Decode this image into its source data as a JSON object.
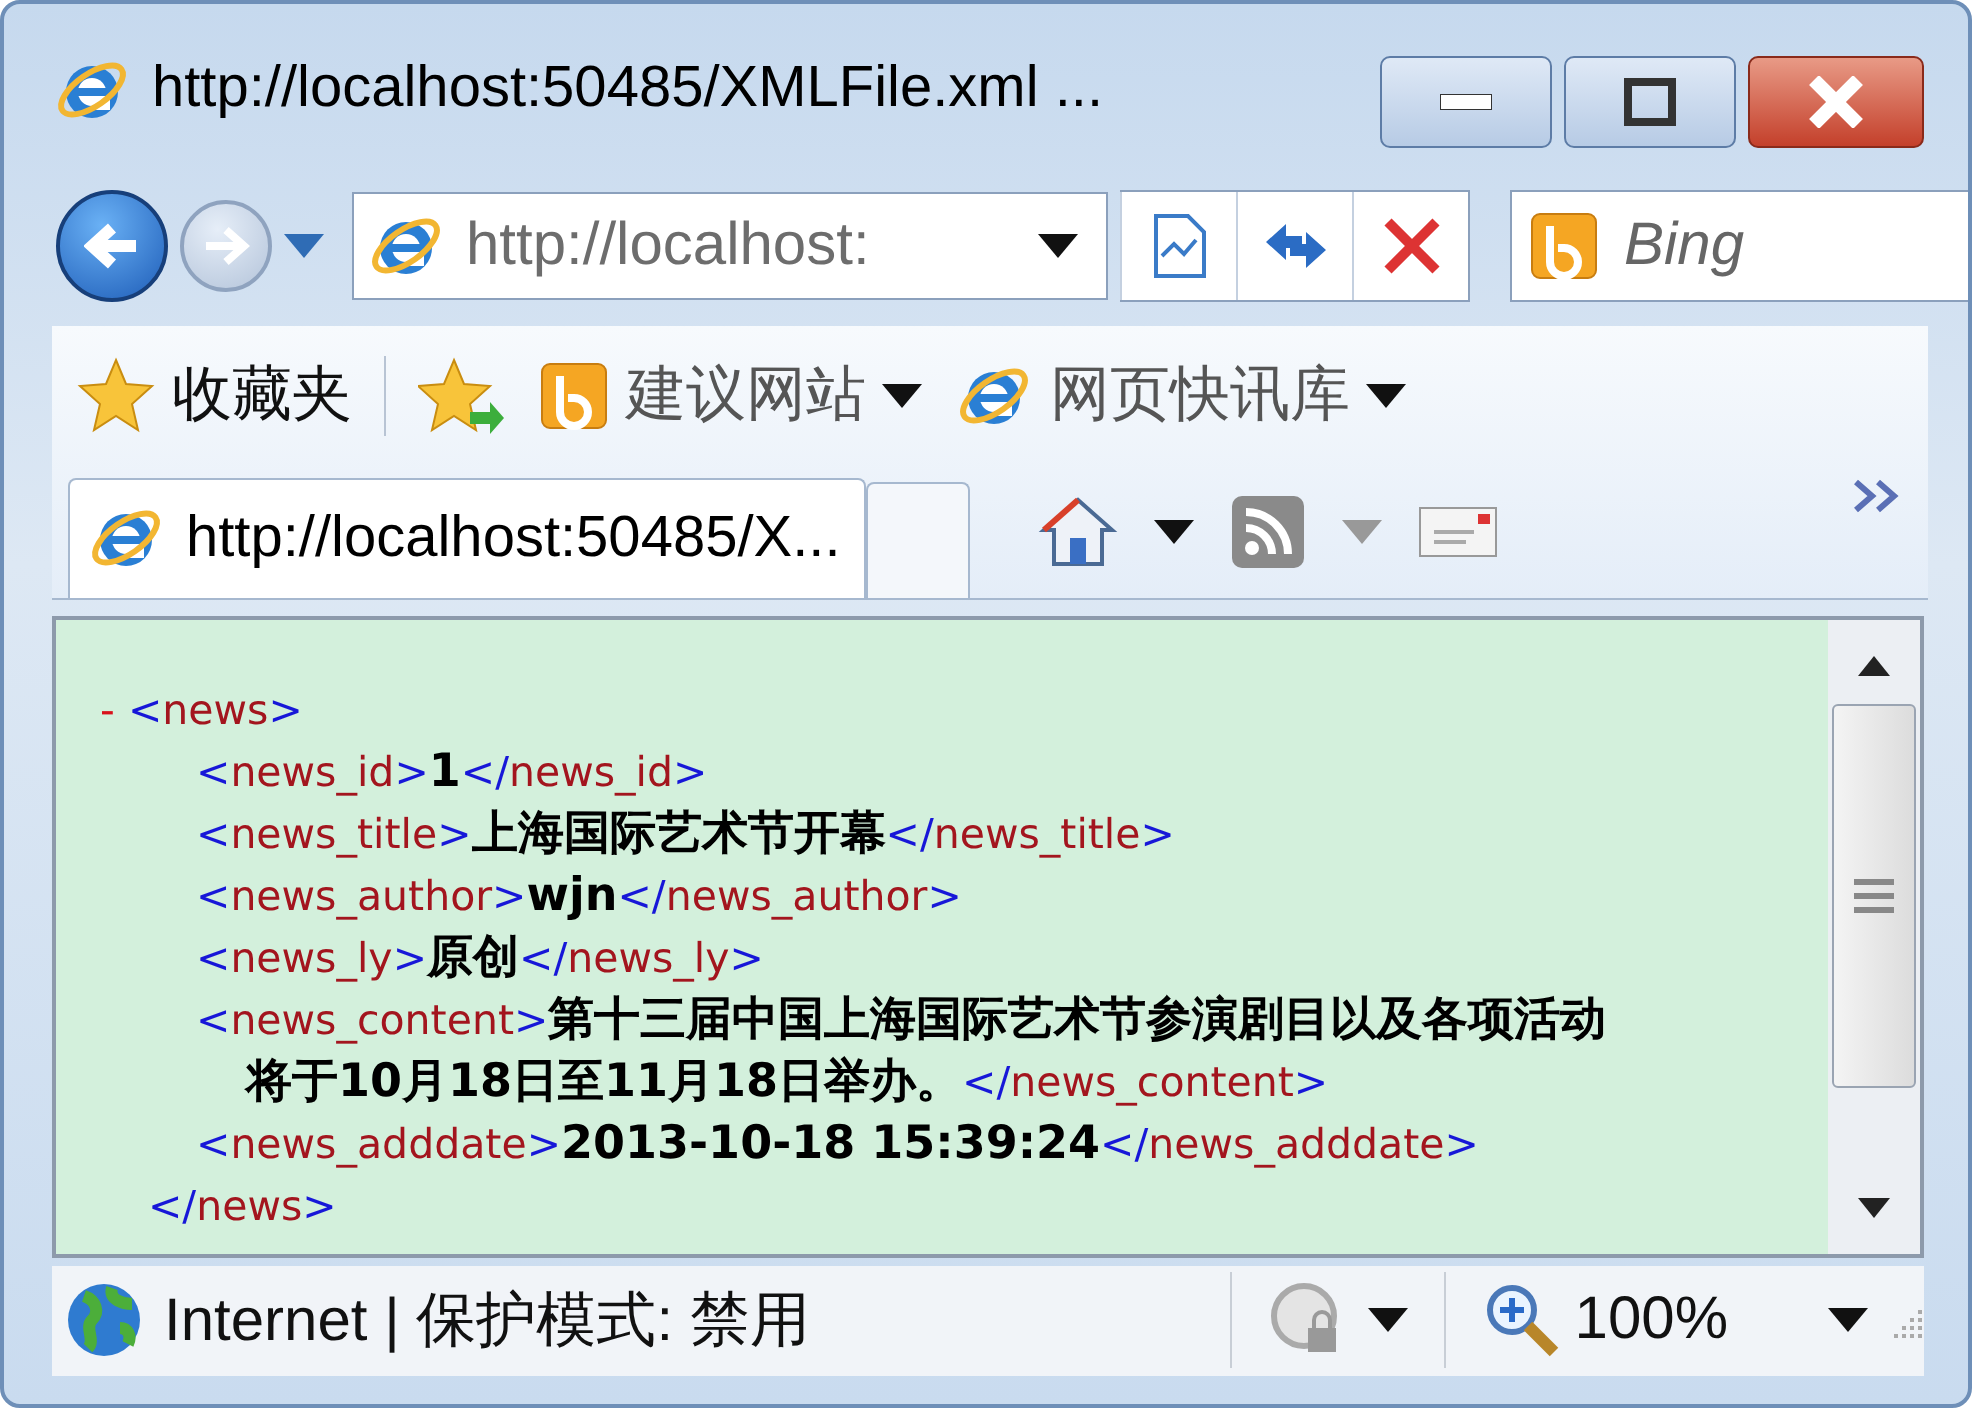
{
  "window": {
    "title": "http://localhost:50485/XMLFile.xml ..."
  },
  "address_bar": {
    "url": "http://localhost:"
  },
  "search": {
    "placeholder": "Bing"
  },
  "favorites_bar": {
    "label": "收藏夹",
    "items": [
      {
        "label": "建议网站",
        "kind": "bing"
      },
      {
        "label": "网页快讯库",
        "kind": "ie"
      }
    ]
  },
  "tabs": [
    {
      "label": "http://localhost:50485/X...",
      "selected": true
    }
  ],
  "xml": {
    "collapse_marker": "-",
    "open_tag": "<news>",
    "close_tag": "</news>",
    "children": [
      {
        "open_tag": "<news_id>",
        "value": "1",
        "close_tag": "</news_id>"
      },
      {
        "open_tag": "<news_title>",
        "value": "上海国际艺术节开幕",
        "close_tag": "</news_title>"
      },
      {
        "open_tag": "<news_author>",
        "value": "wjn",
        "close_tag": "</news_author>"
      },
      {
        "open_tag": "<news_ly>",
        "value": "原创",
        "close_tag": "</news_ly>"
      },
      {
        "open_tag": "<news_content>",
        "value": "第十三届中国上海国际艺术节参演剧目以及各项活动将于10月18日至11月18日举办。",
        "close_tag": "</news_content>"
      },
      {
        "open_tag": "<news_adddate>",
        "value": "2013-10-18 15:39:24",
        "close_tag": "</news_adddate>"
      }
    ]
  },
  "status_bar": {
    "zone": "Internet | 保护模式: 禁用",
    "zoom": "100%"
  }
}
